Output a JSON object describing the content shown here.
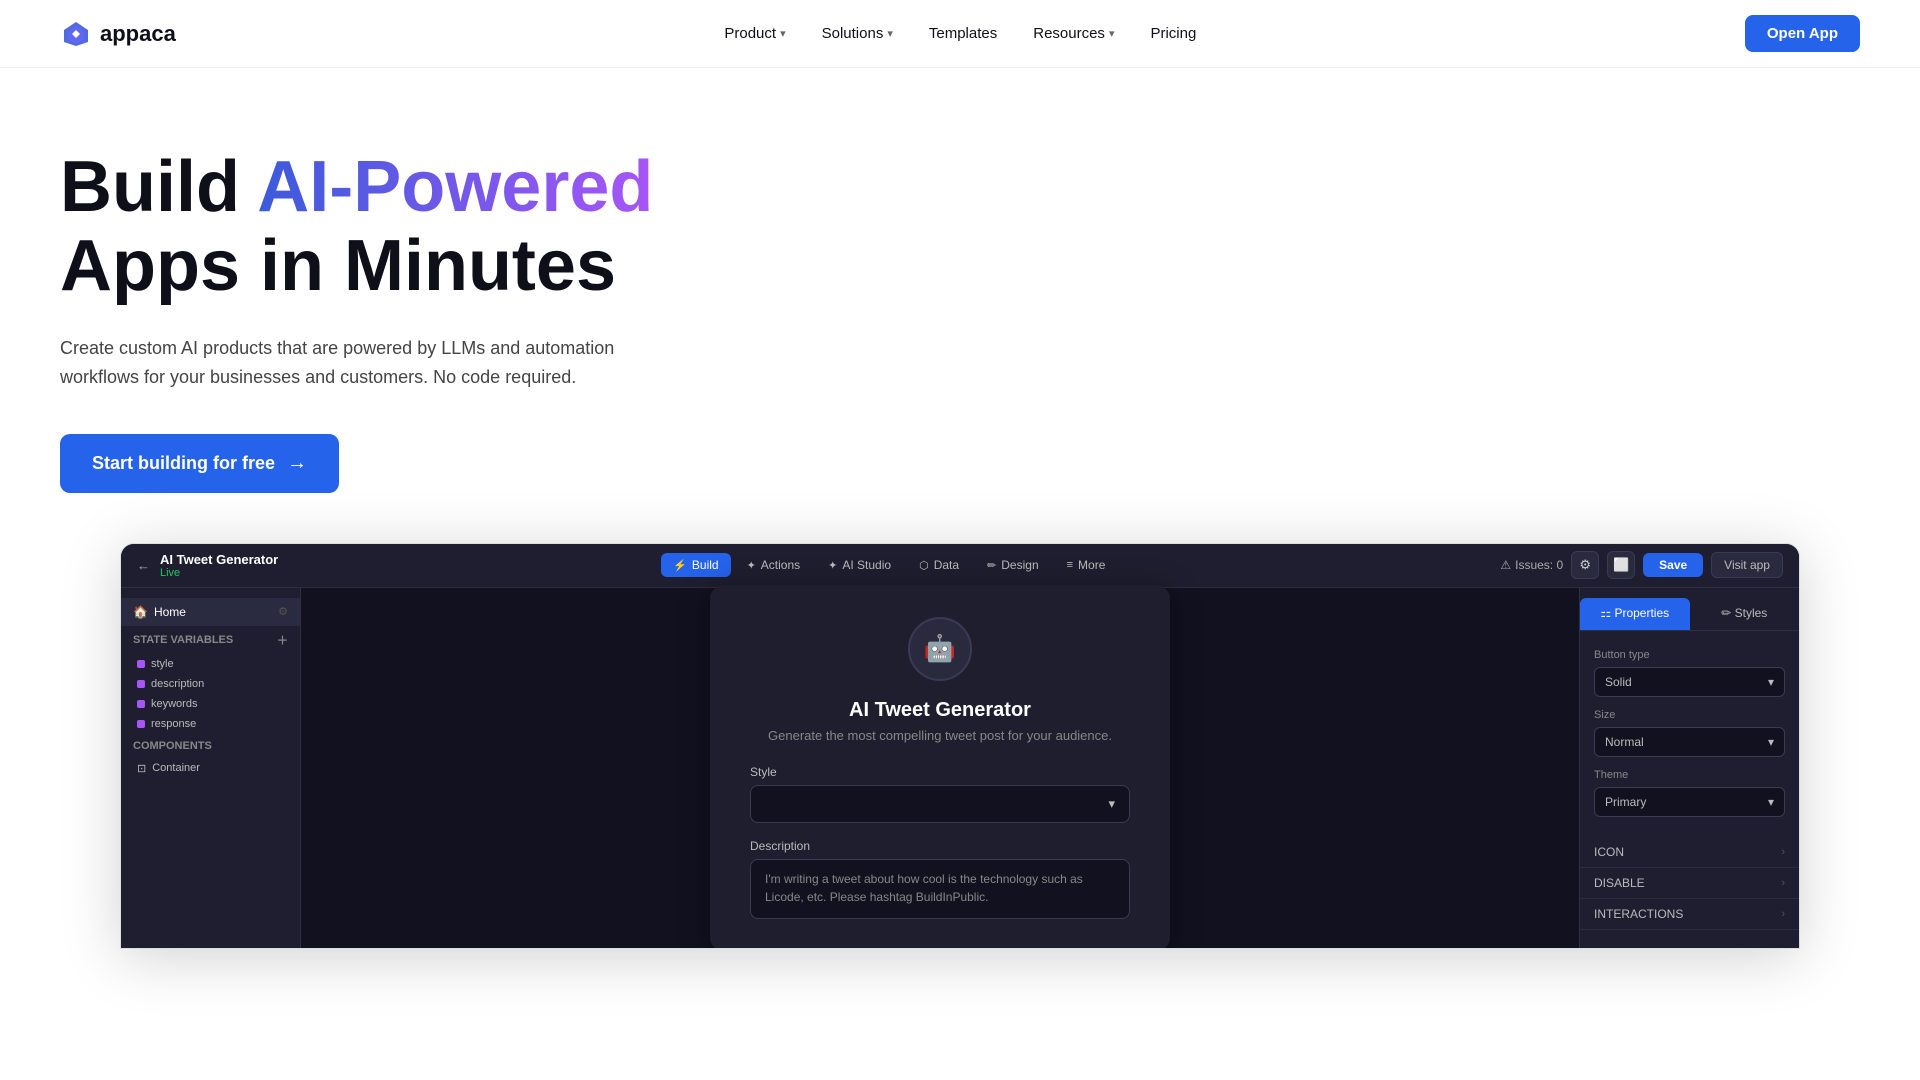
{
  "brand": {
    "name": "appaca",
    "logo_symbol": "✦"
  },
  "nav": {
    "links": [
      {
        "id": "product",
        "label": "Product",
        "has_dropdown": true
      },
      {
        "id": "solutions",
        "label": "Solutions",
        "has_dropdown": true
      },
      {
        "id": "templates",
        "label": "Templates",
        "has_dropdown": false
      },
      {
        "id": "resources",
        "label": "Resources",
        "has_dropdown": true
      },
      {
        "id": "pricing",
        "label": "Pricing",
        "has_dropdown": false
      }
    ],
    "cta_label": "Open App"
  },
  "hero": {
    "title_before": "Build ",
    "title_gradient": "AI-Powered",
    "title_after": "Apps in Minutes",
    "subtitle": "Create custom AI products that are powered by LLMs and automation workflows for your businesses and customers. No code required.",
    "cta_label": "Start building for free",
    "cta_arrow": "→"
  },
  "app_screenshot": {
    "title": "AI Tweet Generator",
    "status": "Live",
    "tabs": [
      {
        "id": "build",
        "label": "Build",
        "icon": "⚡",
        "active": true
      },
      {
        "id": "actions",
        "label": "Actions",
        "icon": "✦"
      },
      {
        "id": "ai_studio",
        "label": "AI Studio",
        "icon": "✦"
      },
      {
        "id": "data",
        "label": "Data",
        "icon": "⬡"
      },
      {
        "id": "design",
        "label": "Design",
        "icon": "✏"
      },
      {
        "id": "more",
        "label": "More",
        "icon": "≡"
      }
    ],
    "topbar_right": {
      "issues_label": "Issues: 0",
      "save_label": "Save"
    },
    "sidebar": {
      "home_label": "Home",
      "state_vars_label": "State variables",
      "vars": [
        {
          "name": "style",
          "color": "purple"
        },
        {
          "name": "description",
          "color": "purple"
        },
        {
          "name": "keywords",
          "color": "purple"
        },
        {
          "name": "response",
          "color": "purple"
        }
      ],
      "components_label": "Components",
      "components_sub": "Container"
    },
    "canvas": {
      "card_title": "AI Tweet Generator",
      "card_subtitle": "Generate the most compelling tweet post for your audience.",
      "field_style_label": "Style",
      "field_description_label": "Description",
      "field_description_placeholder": "I'm writing a tweet about how cool is the technology such as Licode, etc. Please hashtag BuildInPublic.",
      "logo_icon": "🤖"
    },
    "panel": {
      "tab_properties": "Properties",
      "tab_styles": "Styles",
      "button_type_label": "Button type",
      "button_type_value": "Solid",
      "size_label": "Size",
      "size_value": "Normal",
      "theme_label": "Theme",
      "theme_value": "Primary",
      "rows": [
        {
          "label": "ICON"
        },
        {
          "label": "DISABLE"
        },
        {
          "label": "INTERACTIONS"
        }
      ]
    }
  }
}
